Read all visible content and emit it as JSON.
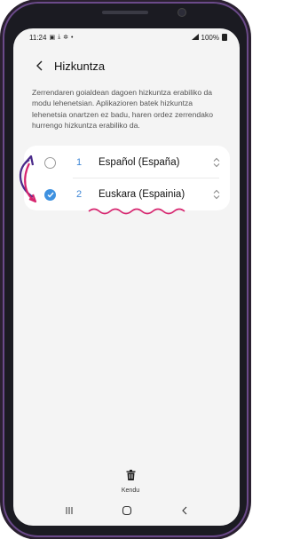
{
  "statusbar": {
    "time": "11:24",
    "battery": "100%",
    "icons": [
      "notification-icon",
      "download-icon",
      "settings-icon",
      "dot-icon",
      "signal-icon",
      "battery-icon"
    ]
  },
  "header": {
    "title": "Hizkuntza",
    "back_icon": "back-chevron-icon"
  },
  "description": "Zerrendaren goialdean dagoen hizkuntza erabiliko da modu lehenetsian. Aplikazioren batek hizkuntza lehenetsia onartzen ez badu, haren ordez zerrendako hurrengo hizkuntza erabiliko da.",
  "languages": [
    {
      "number": "1",
      "name": "Español (España)",
      "selected": false
    },
    {
      "number": "2",
      "name": "Euskara (Espainia)",
      "selected": true
    }
  ],
  "remove_button": {
    "label": "Kendu",
    "icon": "trash-icon"
  },
  "navbar": {
    "buttons": [
      "recents-icon",
      "home-icon",
      "back-icon"
    ]
  },
  "colors": {
    "accent": "#3e91e0",
    "annotation": "#d6246e",
    "annotation_arrow": "#4a2a8a"
  }
}
